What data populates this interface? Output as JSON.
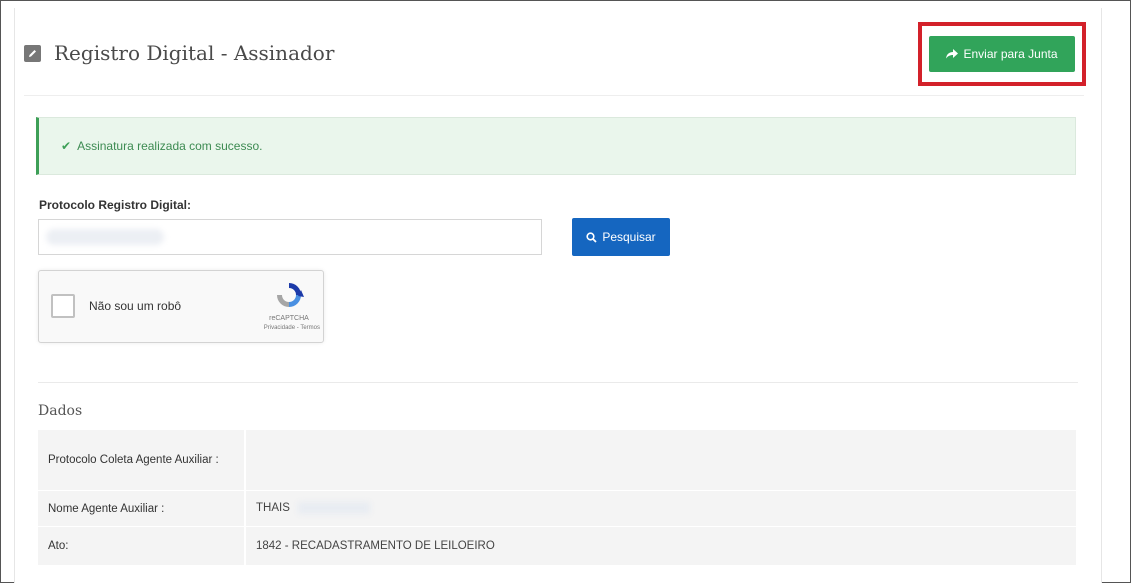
{
  "header": {
    "title": "Registro Digital - Assinador",
    "send_button": "Enviar para Junta"
  },
  "alert": {
    "message": "Assinatura realizada com sucesso."
  },
  "form": {
    "protocol_label": "Protocolo Registro Digital:",
    "protocol_value": "",
    "search_button": "Pesquisar"
  },
  "captcha": {
    "label": "Não sou um robô",
    "brand": "reCAPTCHA",
    "terms": "Privacidade - Termos"
  },
  "data_section": {
    "title": "Dados",
    "rows": [
      {
        "key": "Protocolo Coleta Agente Auxiliar :",
        "value": ""
      },
      {
        "key": "Nome Agente Auxiliar :",
        "value": "THAIS"
      },
      {
        "key": "Ato:",
        "value": "1842 - RECADASTRAMENTO DE LEILOEIRO"
      }
    ]
  },
  "colors": {
    "send_button": "#31a45a",
    "highlight_box": "#d3212a",
    "search_button": "#1566c0",
    "alert_background": "#eaf6ec"
  },
  "icons": [
    "edit-icon",
    "share-arrow-icon",
    "check-icon",
    "search-icon",
    "recaptcha-icon"
  ]
}
